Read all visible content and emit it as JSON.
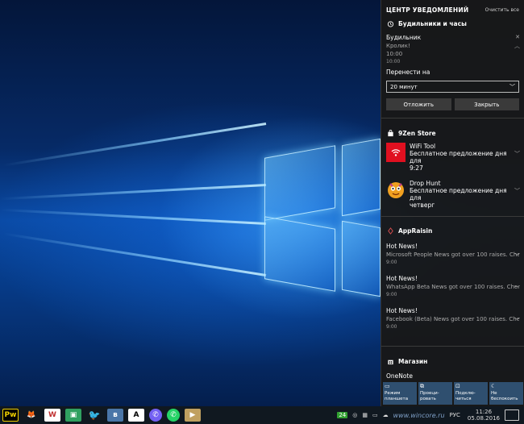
{
  "panel": {
    "title": "ЦЕНТР УВЕДОМЛЕНИЙ",
    "clear_all": "Очистить все"
  },
  "alarms": {
    "group_name": "Будильники и часы",
    "title": "Будильник",
    "subtitle": "Кролик!",
    "time_big": "10:00",
    "time_small": "10:00",
    "snooze_label": "Перенести на",
    "snooze_value": "20 минут",
    "snooze_button": "Отложить",
    "dismiss_button": "Закрыть"
  },
  "store": {
    "group_name": "9Zen Store",
    "items": [
      {
        "title": "WiFi Tool",
        "body": "Бесплатное предложение дня для",
        "time": "9:27"
      },
      {
        "title": "Drop Hunt",
        "body": "Бесплатное предложение дня для",
        "time": "четверг"
      }
    ]
  },
  "appraisin": {
    "group_name": "AppRaisin",
    "items": [
      {
        "title": "Hot News!",
        "body": "Microsoft People News got over 100 raises. Chec",
        "time": "9:00"
      },
      {
        "title": "Hot News!",
        "body": "WhatsApp Beta News got over 100 raises. Chec",
        "time": "9:00"
      },
      {
        "title": "Hot News!",
        "body": "Facebook (Beta) News got over 100 raises. Chec",
        "time": "9:00"
      }
    ]
  },
  "magazin": {
    "group_name": "Магазин",
    "item_title": "OneNote"
  },
  "quick_actions": [
    {
      "label": "Режим планшета",
      "icon": "tablet-icon"
    },
    {
      "label": "Проеци-ровать",
      "icon": "project-icon"
    },
    {
      "label": "Подклю-читься",
      "icon": "connect-icon"
    },
    {
      "label": "Не беспокоить",
      "icon": "moon-icon"
    }
  ],
  "taskbar": {
    "language": "РУС",
    "time": "11:26",
    "date": "05.08.2016",
    "badge": "24",
    "watermark": "www.wincore.ru",
    "icons": [
      "pw-icon",
      "gimp-icon",
      "word-icon",
      "app-icon",
      "twitter-icon",
      "vk-icon",
      "font-icon",
      "viber-icon",
      "whatsapp-icon",
      "media-icon"
    ]
  },
  "colors": {
    "panel_bg": "#181818",
    "quick_action_bg": "#2f4f6f",
    "wifi_tool_red": "#e01020",
    "twitter_blue": "#1da1f2",
    "whatsapp_green": "#25d366",
    "viber_purple": "#7360f2"
  }
}
